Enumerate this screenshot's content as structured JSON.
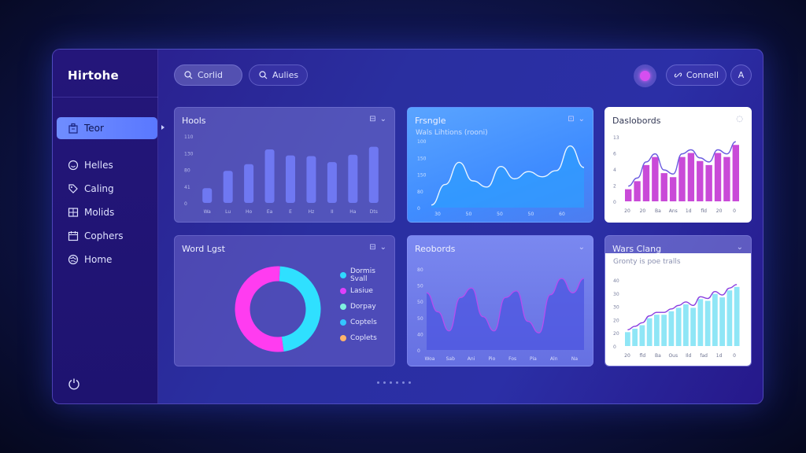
{
  "app": {
    "brand": "Hirtohe"
  },
  "sidebar": {
    "items": [
      {
        "label": "Teor",
        "icon": "building-icon",
        "active": true
      },
      {
        "label": "Helles",
        "icon": "smile-icon"
      },
      {
        "label": "Caling",
        "icon": "tag-icon"
      },
      {
        "label": "Molids",
        "icon": "grid-icon"
      },
      {
        "label": "Cophers",
        "icon": "calendar-icon"
      },
      {
        "label": "Home",
        "icon": "globe-icon"
      }
    ]
  },
  "topbar": {
    "search_label": "Corlid",
    "filter_label": "Aulies",
    "connect_label": "Connell",
    "user_label": "A"
  },
  "cards": {
    "bar": {
      "title": "Hools",
      "y_ticks": [
        "110",
        "130",
        "80",
        "41",
        "0"
      ],
      "x_labels": [
        "Wa",
        "Lu",
        "Ho",
        "Ea",
        "E",
        "Hz",
        "II",
        "Ha",
        "Dts"
      ]
    },
    "area_blue": {
      "title": "Frsngle",
      "subtitle": "Wals Lihtions (rooni)",
      "y_ticks": [
        "100",
        "150",
        "150",
        "80",
        "0"
      ],
      "x_labels": [
        "30",
        "50",
        "50",
        "50",
        "60"
      ]
    },
    "dashboards": {
      "title": "Daslobords",
      "y_ticks": [
        "13",
        "6",
        "4",
        "2",
        "0"
      ],
      "x_labels": [
        "20",
        "20",
        "Ba",
        "Ans",
        "1d",
        "fld",
        "20",
        "0"
      ]
    },
    "donut": {
      "title": "Word Lgst",
      "legend": [
        {
          "label": "Dormis Svall",
          "color": "#2fd8ff"
        },
        {
          "label": "Lasiue",
          "color": "#e040fb"
        },
        {
          "label": "Dorpay",
          "color": "#7ff0e0"
        },
        {
          "label": "Coptels",
          "color": "#34c6ff"
        },
        {
          "label": "Coplets",
          "color": "#ffb36b"
        }
      ]
    },
    "area_purple": {
      "title": "Reobords",
      "y_ticks": [
        "80",
        "50",
        "50",
        "50",
        "40",
        "0"
      ],
      "x_labels": [
        "Woa",
        "Sab",
        "Ani",
        "Pio",
        "Fos",
        "Pia",
        "Aln",
        "Na"
      ]
    },
    "wars": {
      "title": "Wars Clang",
      "subtitle": "Gronty is poe tralls",
      "y_ticks": [
        "40",
        "30",
        "30",
        "20",
        "20",
        "0"
      ],
      "x_labels": [
        "20",
        "fld",
        "Ba",
        "Ous",
        "Ild",
        "fad",
        "1d",
        "0"
      ]
    }
  },
  "chart_data": [
    {
      "type": "bar",
      "title": "Hools",
      "categories": [
        "Wa",
        "Lu",
        "Ho",
        "Ea",
        "E",
        "Hz",
        "II",
        "Ha",
        "Dts"
      ],
      "values": [
        22,
        48,
        58,
        80,
        71,
        70,
        61,
        72,
        84
      ]
    },
    {
      "type": "area",
      "title": "Frsngle",
      "x": [
        "30",
        "50",
        "50",
        "50",
        "60"
      ],
      "values": [
        5,
        45,
        88,
        52,
        40,
        80,
        56,
        70,
        60,
        72,
        120,
        78
      ]
    },
    {
      "type": "bar",
      "title": "Daslobords",
      "categories": [
        "20",
        "20",
        "Ba",
        "Ans",
        "1d",
        "fld",
        "20",
        "0"
      ],
      "values": [
        3,
        5,
        9,
        11,
        7,
        6,
        11,
        12,
        10,
        9,
        12,
        11,
        14
      ],
      "colors": {
        "bars": "#c94ad8",
        "line": "#6b5ce0"
      }
    },
    {
      "type": "pie",
      "title": "Word Lgst",
      "labels": [
        "Dormis Svall",
        "Lasiue",
        "Dorpay",
        "Coptels",
        "Coplets"
      ],
      "values": [
        47,
        53,
        0,
        0,
        0
      ]
    },
    {
      "type": "area",
      "title": "Reobords",
      "x": [
        "Woa",
        "Sab",
        "Ani",
        "Pio",
        "Fos",
        "Pia",
        "Aln",
        "Na"
      ],
      "values": [
        60,
        40,
        20,
        55,
        65,
        35,
        20,
        55,
        62,
        30,
        18,
        58,
        75,
        60,
        75
      ]
    },
    {
      "type": "bar",
      "title": "Wars Clang",
      "categories": [
        "20",
        "fld",
        "Ba",
        "Ous",
        "Ild",
        "fad",
        "1d",
        "0"
      ],
      "values": [
        8,
        10,
        12,
        16,
        18,
        18,
        20,
        22,
        24,
        22,
        27,
        26,
        30,
        28,
        32,
        34
      ],
      "colors": {
        "bars": "#8fe6f6",
        "line": "#8a3ee0"
      }
    }
  ]
}
